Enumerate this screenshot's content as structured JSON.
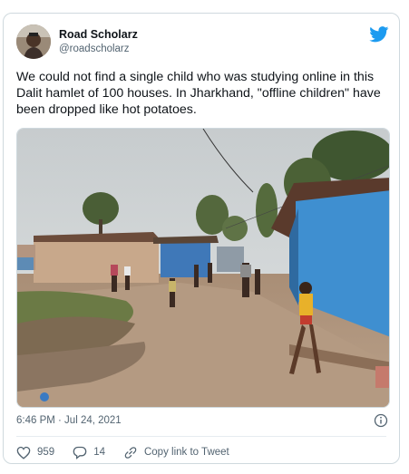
{
  "tweet": {
    "author_name": "Road Scholarz",
    "author_handle": "@roadscholarz",
    "text": "We could not find a single child who was studying online in this Dalit hamlet of 100 houses. In Jharkhand, \"offline children\" have been dropped like hot potatoes.",
    "timestamp": "6:46 PM · Jul 24, 2021",
    "like_count": "959",
    "reply_count": "14",
    "copy_link_label": "Copy link to Tweet"
  },
  "colors": {
    "twitter_blue": "#1d9bf0",
    "muted_text": "#536471",
    "border": "#cfd9de"
  },
  "icons": [
    "avatar-photo",
    "twitter-bird-icon",
    "info-icon",
    "heart-icon",
    "reply-icon",
    "link-icon"
  ]
}
